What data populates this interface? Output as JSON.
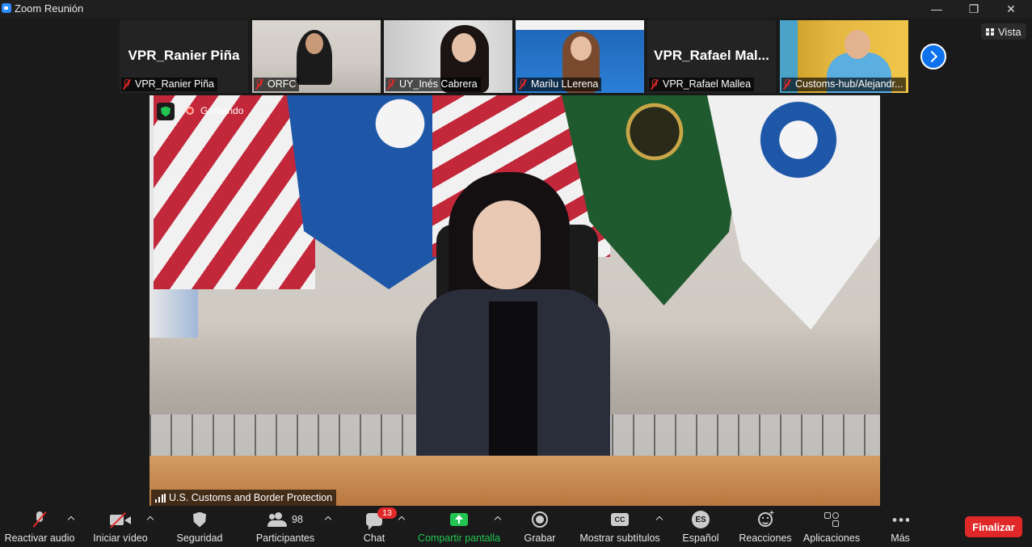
{
  "window": {
    "title": "Zoom Reunión"
  },
  "view": {
    "label": "Vista"
  },
  "thumbnails": [
    {
      "big_name": "VPR_Ranier Piña",
      "label": "VPR_Ranier Piña"
    },
    {
      "big_name": "",
      "label": "ORFC"
    },
    {
      "big_name": "",
      "label": "UY_Inés Cabrera"
    },
    {
      "big_name": "",
      "label": "Marilu LLerena"
    },
    {
      "big_name": "VPR_Rafael  Mal...",
      "label": "VPR_Rafael Mallea"
    },
    {
      "big_name": "",
      "label": "Customs-hub/Alejandr..."
    }
  ],
  "main": {
    "recording_label": "Grabando",
    "speaker_label": "U.S. Customs and Border Protection"
  },
  "toolbar": {
    "audio": "Reactivar audio",
    "video": "Iniciar vídeo",
    "security": "Seguridad",
    "participants": "Participantes",
    "participants_count": "98",
    "chat": "Chat",
    "chat_badge": "13",
    "share": "Compartir pantalla",
    "record": "Grabar",
    "captions": "Mostrar subtítulos",
    "captions_icon": "CC",
    "language": "Español",
    "language_icon": "ES",
    "reactions": "Reacciones",
    "apps": "Aplicaciones",
    "more": "Más",
    "end": "Finalizar"
  },
  "colors": {
    "end_button": "#e02828",
    "share_green": "#23c552",
    "accent_blue": "#0e72ed"
  }
}
